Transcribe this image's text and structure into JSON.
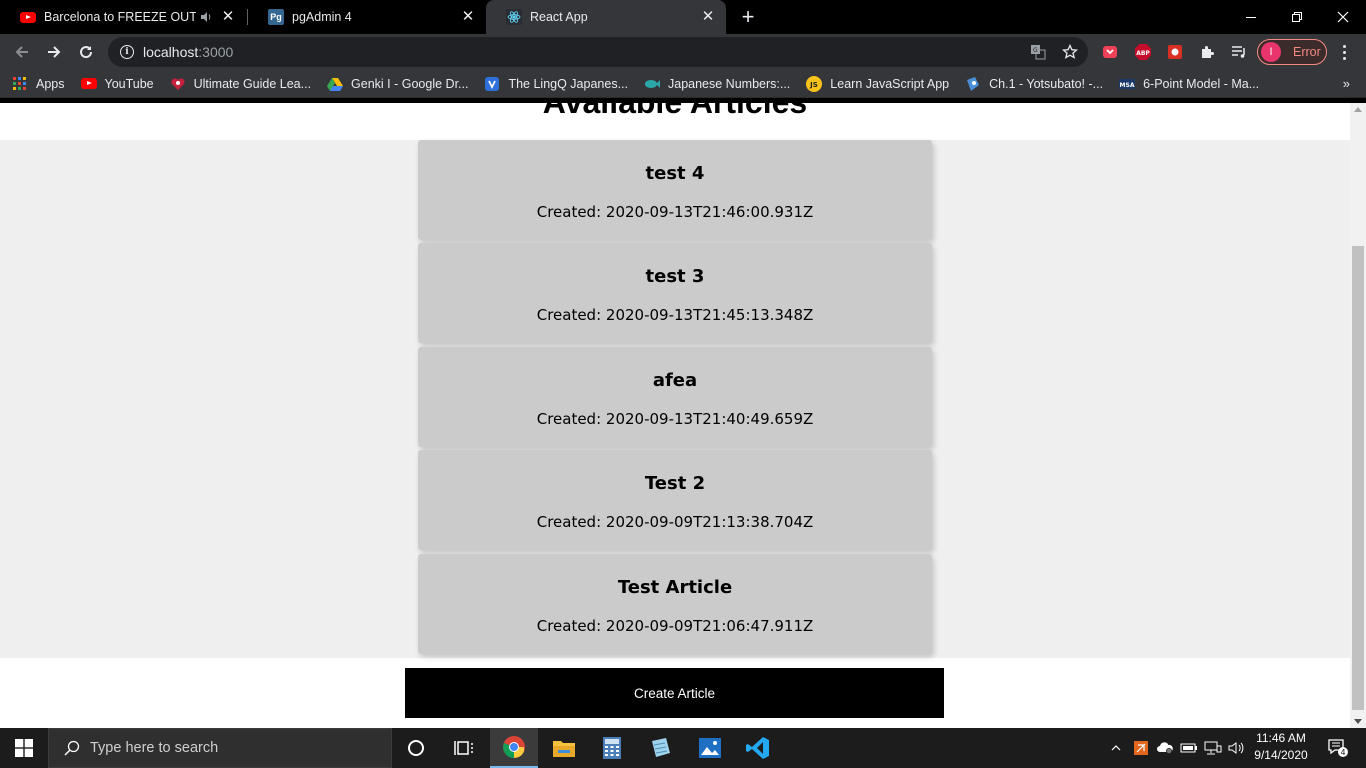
{
  "browser": {
    "tabs": [
      {
        "title": "Barcelona to FREEZE OUT Lu",
        "favicon": "youtube-icon",
        "audio": true
      },
      {
        "title": "pgAdmin 4",
        "favicon": "pgadmin-icon"
      },
      {
        "title": "React App",
        "favicon": "react-icon",
        "active": true
      }
    ],
    "pgadmin_favicon_text": "Pg",
    "url_host": "localhost",
    "url_port": ":3000",
    "profile_initial": "I",
    "profile_status": "Error",
    "abp_label": "ABP",
    "bookmarks": [
      {
        "label": "Apps",
        "icon": "apps-grid-icon"
      },
      {
        "label": "YouTube",
        "icon": "youtube-icon"
      },
      {
        "label": "Ultimate Guide Lea...",
        "icon": "heart-icon"
      },
      {
        "label": "Genki I - Google Dr...",
        "icon": "google-drive-icon"
      },
      {
        "label": "The LingQ Japanes...",
        "icon": "lingq-icon"
      },
      {
        "label": "Japanese Numbers:...",
        "icon": "fish-icon"
      },
      {
        "label": "Learn JavaScript App",
        "icon": "js-icon"
      },
      {
        "label": "Ch.1 - Yotsubato! -...",
        "icon": "manga-icon"
      },
      {
        "label": "6-Point Model - Ma...",
        "icon": "msa-icon"
      }
    ],
    "js_icon_text": "JS",
    "msa_icon_text": "MSA",
    "more_bookmarks": "»"
  },
  "page": {
    "heading": "Available Articles",
    "articles": [
      {
        "title": "test 4",
        "created": "Created: 2020-09-13T21:46:00.931Z"
      },
      {
        "title": "test 3",
        "created": "Created: 2020-09-13T21:45:13.348Z"
      },
      {
        "title": "afea",
        "created": "Created: 2020-09-13T21:40:49.659Z"
      },
      {
        "title": "Test 2",
        "created": "Created: 2020-09-09T21:13:38.704Z"
      },
      {
        "title": "Test Article",
        "created": "Created: 2020-09-09T21:06:47.911Z"
      }
    ],
    "create_button": "Create Article"
  },
  "taskbar": {
    "search_placeholder": "Type here to search",
    "time": "11:46 AM",
    "date": "9/14/2020",
    "notification_count": "4",
    "pinned": [
      "cortana-icon",
      "task-view-icon",
      "chrome-icon",
      "file-explorer-icon",
      "calculator-icon",
      "notepad-icon",
      "photos-icon",
      "vscode-icon"
    ]
  },
  "colors": {
    "card_bg": "#cbcbcb",
    "list_bg": "#efefef",
    "button_bg": "#000000",
    "profile_accent": "#f28b82"
  }
}
